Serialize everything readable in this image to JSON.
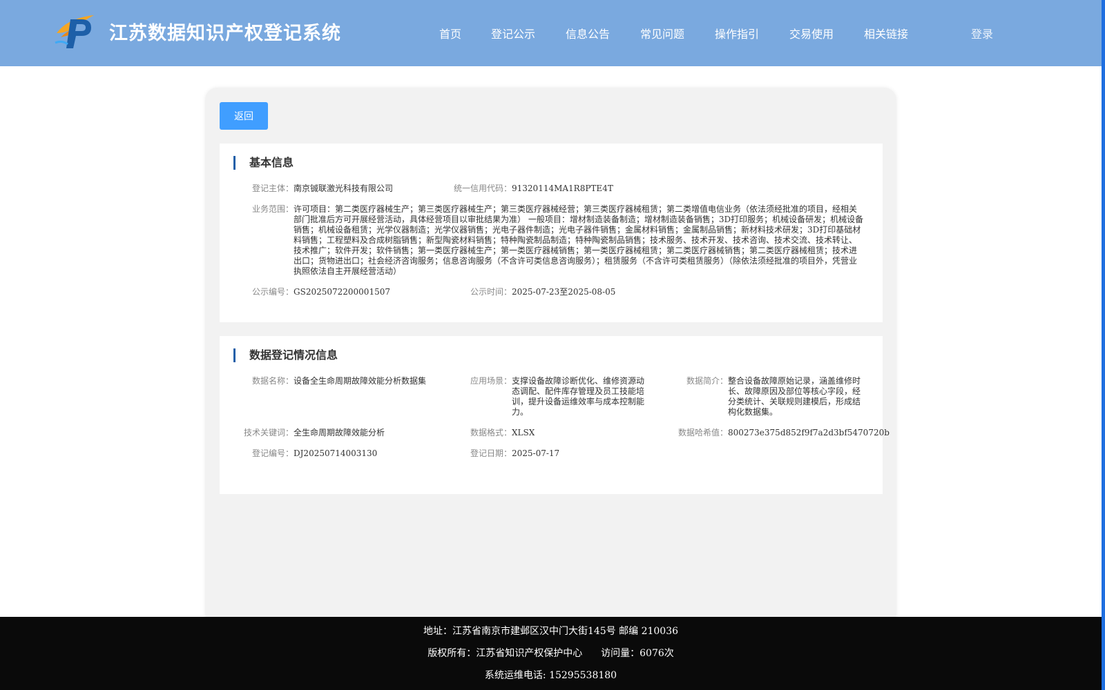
{
  "header": {
    "title": "江苏数据知识产权登记系统",
    "nav": [
      "首页",
      "登记公示",
      "信息公告",
      "常见问题",
      "操作指引",
      "交易使用",
      "相关链接"
    ],
    "login": "登录"
  },
  "panel": {
    "back_label": "返回",
    "basic": {
      "title": "基本信息",
      "subject_label": "登记主体：",
      "subject": "南京铖联激光科技有限公司",
      "credit_label": "统一信用代码：",
      "credit": "91320114MA1R8PTE4T",
      "scope_label": "业务范围：",
      "scope": "许可项目：第二类医疗器械生产；第三类医疗器械生产；第三类医疗器械经营；第三类医疗器械租赁；第二类增值电信业务（依法须经批准的项目，经相关部门批准后方可开展经营活动，具体经营项目以审批结果为准） 一般项目：增材制造装备制造；增材制造装备销售；3D打印服务；机械设备研发；机械设备销售；机械设备租赁；光学仪器制造；光学仪器销售；光电子器件制造；光电子器件销售；金属材料销售；金属制品销售；新材料技术研发；3D打印基础材料销售；工程塑料及合成树脂销售；新型陶瓷材料销售；特种陶瓷制品制造；特种陶瓷制品销售；技术服务、技术开发、技术咨询、技术交流、技术转让、技术推广；软件开发；软件销售；第一类医疗器械生产；第一类医疗器械销售；第一类医疗器械租赁；第二类医疗器械销售；第二类医疗器械租赁；技术进出口；货物进出口；社会经济咨询服务；信息咨询服务（不含许可类信息咨询服务）；租赁服务（不含许可类租赁服务）（除依法须经批准的项目外，凭营业执照依法自主开展经营活动）",
      "notice_no_label": "公示编号：",
      "notice_no": "GS2025072200001507",
      "notice_time_label": "公示时间：",
      "notice_time": "2025-07-23至2025-08-05"
    },
    "data": {
      "title": "数据登记情况信息",
      "name_label": "数据名称：",
      "name": "设备全生命周期故障效能分析数据集",
      "scene_label": "应用场景：",
      "scene": "支撑设备故障诊断优化、维修资源动态调配、配件库存管理及员工技能培训，提升设备运维效率与成本控制能力。",
      "intro_label": "数据简介：",
      "intro": "整合设备故障原始记录，涵盖维修时长、故障原因及部位等核心字段，经分类统计、关联规则建模后，形成结构化数据集。",
      "keyword_label": "技术关键词：",
      "keyword": "全生命周期故障效能分析",
      "format_label": "数据格式：",
      "format": "XLSX",
      "hash_label": "数据哈希值：",
      "hash": "800273e375d852f9f7a2d3bf5470720b",
      "reg_no_label": "登记编号：",
      "reg_no": "DJ20250714003130",
      "reg_date_label": "登记日期：",
      "reg_date": "2025-07-17"
    }
  },
  "footer": {
    "address": "地址：江苏省南京市建邺区汉中门大街145号 邮编 210036",
    "copyright": "版权所有：江苏省知识产权保护中心",
    "visits": "访问量：6076次",
    "phone": "系统运维电话: 15295538180"
  },
  "colors": {
    "header_bg": "#7aa9df",
    "accent_button": "#409eff",
    "section_bar": "#1d5fa8",
    "footer_bg": "#0a0a0a"
  }
}
